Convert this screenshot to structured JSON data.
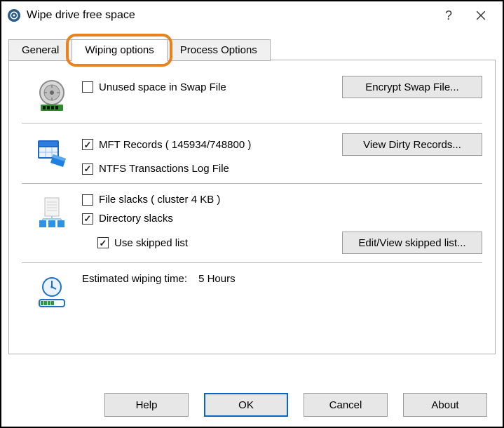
{
  "window": {
    "title": "Wipe drive free space"
  },
  "tabs": {
    "general": "General",
    "wiping": "Wiping options",
    "process": "Process Options",
    "active": "wiping"
  },
  "swap": {
    "unused_label": "Unused space in Swap File",
    "unused_checked": false,
    "encrypt_btn": "Encrypt Swap File..."
  },
  "mft": {
    "records_label": "MFT Records ( 145934/748800 )",
    "records_checked": true,
    "ntfs_label": "NTFS Transactions Log File",
    "ntfs_checked": true,
    "view_btn": "View Dirty Records..."
  },
  "slacks": {
    "file_label": "File slacks ( cluster 4 KB )",
    "file_checked": false,
    "dir_label": "Directory slacks",
    "dir_checked": true,
    "skipped_label": "Use skipped list",
    "skipped_checked": true,
    "edit_btn": "Edit/View skipped list..."
  },
  "estimate": {
    "label": "Estimated wiping time:",
    "value": "5 Hours"
  },
  "footer": {
    "help": "Help",
    "ok": "OK",
    "cancel": "Cancel",
    "about": "About"
  },
  "highlight": {
    "tab": "wiping"
  }
}
